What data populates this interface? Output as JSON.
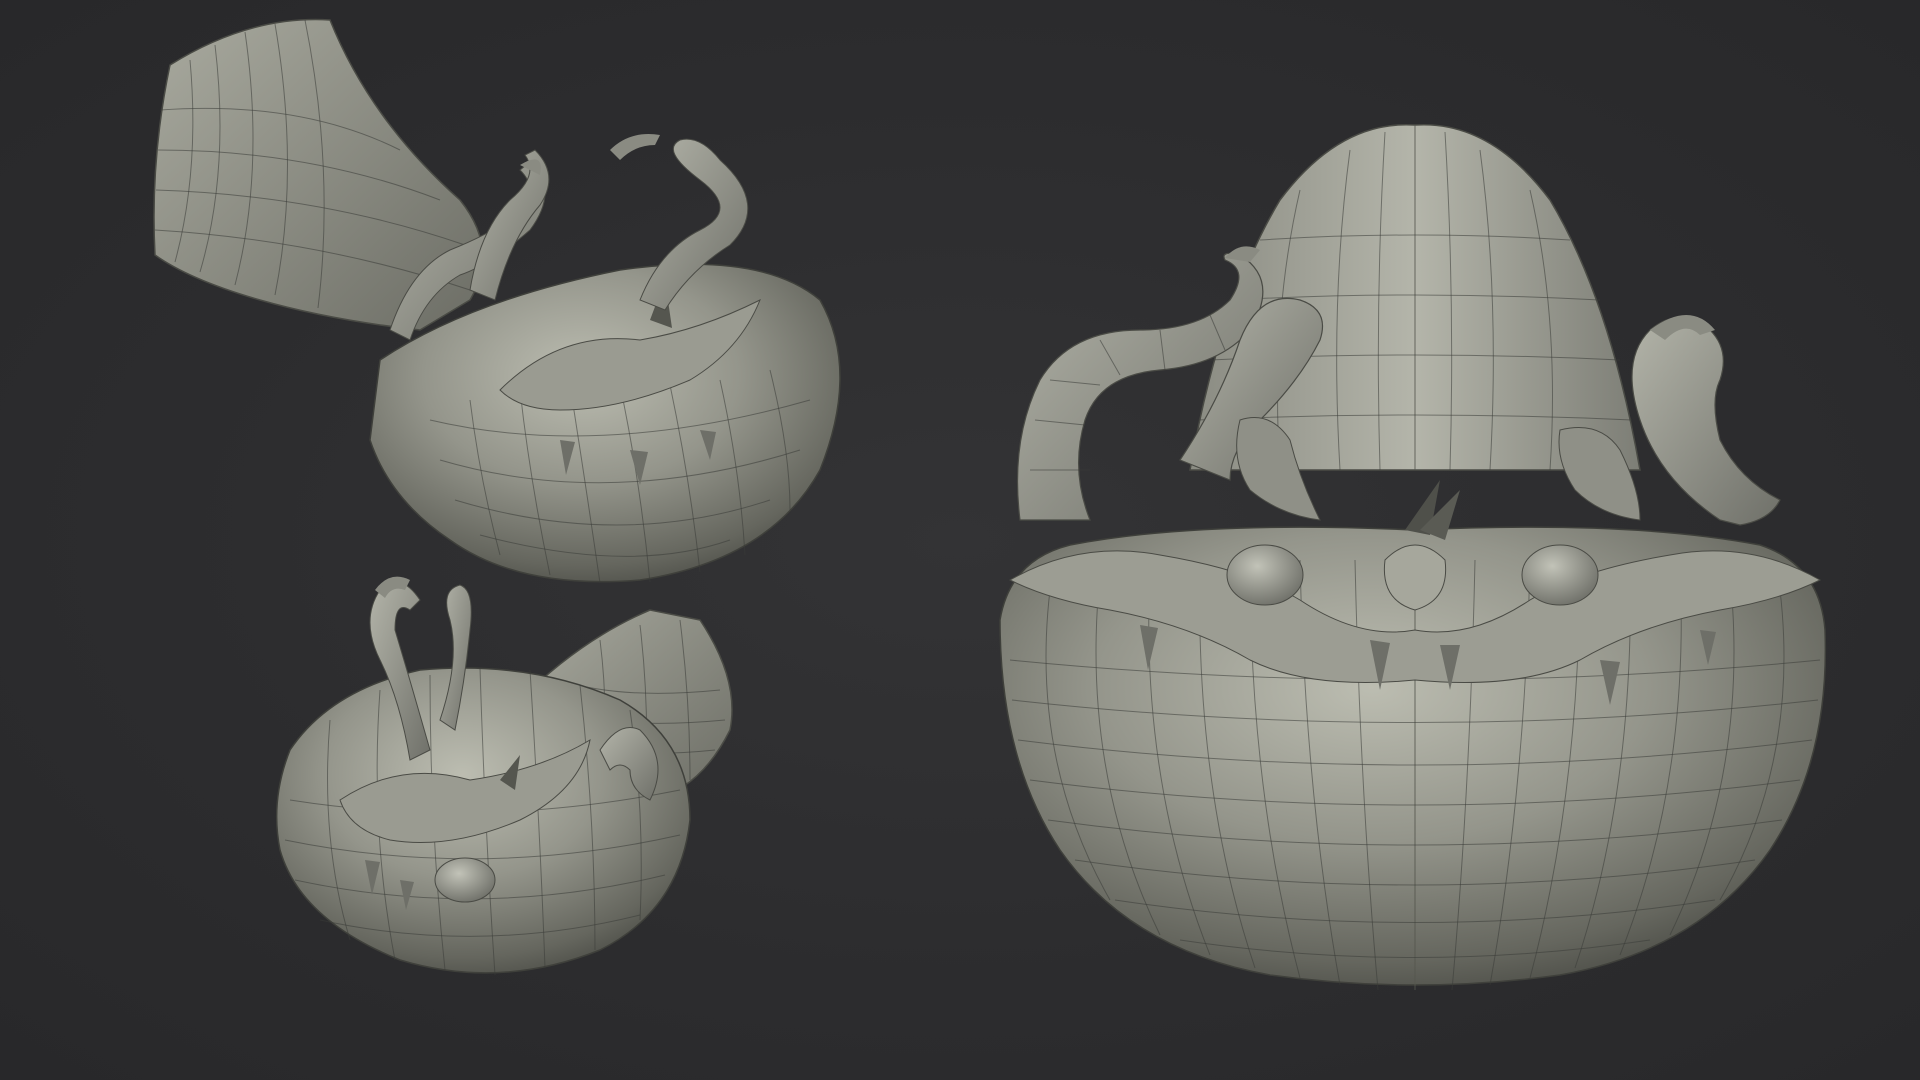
{
  "scene": {
    "background_color": "#2d2d2f",
    "material_color": "#8e8f86",
    "material_highlight": "#b9baae",
    "material_shadow": "#4a4b45",
    "wire_color": "#3b3d38",
    "views": [
      {
        "name": "view-top-left",
        "description_icon": "sculpt-mesh-angled"
      },
      {
        "name": "view-bottom-left",
        "description_icon": "sculpt-mesh-underside"
      },
      {
        "name": "view-right",
        "description_icon": "sculpt-mesh-front"
      }
    ]
  }
}
